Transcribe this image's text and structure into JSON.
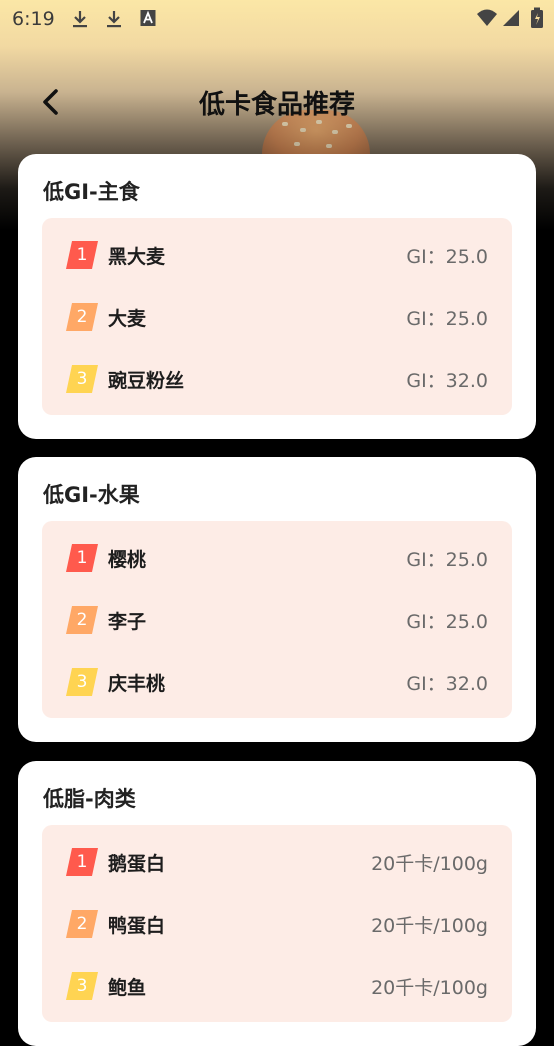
{
  "status_bar": {
    "time": "6:19"
  },
  "header": {
    "title": "低卡食品推荐"
  },
  "colors": {
    "rank1": "#ff5a4d",
    "rank2": "#ffa866",
    "rank3": "#ffd452",
    "list_bg": "#fdece6"
  },
  "cards": [
    {
      "title": "低GI-主食",
      "items": [
        {
          "rank": "1",
          "name": "黑大麦",
          "value": "GI：25.0"
        },
        {
          "rank": "2",
          "name": "大麦",
          "value": "GI：25.0"
        },
        {
          "rank": "3",
          "name": "豌豆粉丝",
          "value": "GI：32.0"
        }
      ]
    },
    {
      "title": "低GI-水果",
      "items": [
        {
          "rank": "1",
          "name": "樱桃",
          "value": "GI：25.0"
        },
        {
          "rank": "2",
          "name": "李子",
          "value": "GI：25.0"
        },
        {
          "rank": "3",
          "name": "庆丰桃",
          "value": "GI：32.0"
        }
      ]
    },
    {
      "title": "低脂-肉类",
      "items": [
        {
          "rank": "1",
          "name": "鹅蛋白",
          "value": "20千卡/100g"
        },
        {
          "rank": "2",
          "name": "鸭蛋白",
          "value": "20千卡/100g"
        },
        {
          "rank": "3",
          "name": "鲍鱼",
          "value": "20千卡/100g"
        }
      ]
    }
  ]
}
